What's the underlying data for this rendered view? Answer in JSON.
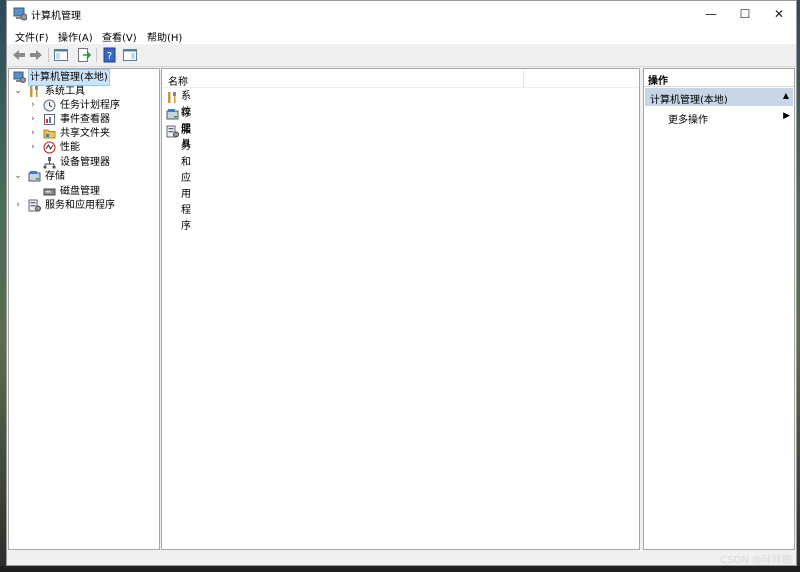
{
  "window": {
    "title": "计算机管理",
    "controls": {
      "minimize": "—",
      "maximize": "☐",
      "close": "✕"
    }
  },
  "menubar": {
    "items": [
      "文件(F)",
      "操作(A)",
      "查看(V)",
      "帮助(H)"
    ]
  },
  "toolbar": {
    "icons": [
      "back-icon",
      "forward-icon",
      "show-hide-tree-icon",
      "export-list-icon",
      "help-icon",
      "show-hide-action-pane-icon"
    ]
  },
  "tree": {
    "root": "计算机管理(本地)",
    "system_tools": "系统工具",
    "task_scheduler": "任务计划程序",
    "event_viewer": "事件查看器",
    "shared_folders": "共享文件夹",
    "performance": "性能",
    "device_manager": "设备管理器",
    "storage": "存储",
    "disk_management": "磁盘管理",
    "services_apps": "服务和应用程序"
  },
  "list": {
    "column_name": "名称",
    "rows": [
      "系统工具",
      "存储",
      "服务和应用程序"
    ]
  },
  "actions": {
    "header": "操作",
    "section": "计算机管理(本地)",
    "more": "更多操作"
  },
  "watermark": "CSDN @咔咔鹿",
  "colors": {
    "selection": "#cce4f7",
    "actions_section": "#c6d6e6",
    "pane_border": "#a6a6a6"
  }
}
